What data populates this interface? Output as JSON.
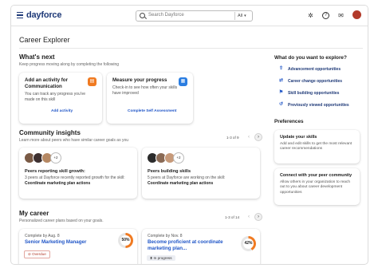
{
  "topbar": {
    "logo": "dayforce",
    "search_placeholder": "Search Dayforce",
    "search_scope": "All",
    "avatar_color": "#b23a2a"
  },
  "page": {
    "title": "Career Explorer"
  },
  "whats_next": {
    "title": "What's next",
    "subtitle": "Keep progress moving along by completing the following",
    "cards": [
      {
        "title": "Add an activity for Communication",
        "desc": "You can track any progress you've made on this skill",
        "link": "Add activity",
        "icon": "clipboard-icon",
        "color": "#f07a21"
      },
      {
        "title": "Measure your progress",
        "desc": "Check-in to see how often your skills have improved",
        "link": "Complete Self Assessment",
        "icon": "document-icon",
        "color": "#2a7de1"
      }
    ]
  },
  "community": {
    "title": "Community insights",
    "subtitle": "Learn more about peers who have similar career goals as you",
    "pager": "1-3 of 9",
    "cards": [
      {
        "avatar_more": "+2",
        "title": "Peers reporting skill growth:",
        "desc": "3 peers at Dayforce recently reported growth for the skill:",
        "skill": "Coordinate marketing plan actions"
      },
      {
        "avatar_more": "+2",
        "title": "Peers building skills",
        "desc": "5 peers at Dayforce are working on the skill:",
        "skill": "Coordinate marketing plan actions"
      }
    ]
  },
  "my_career": {
    "title": "My career",
    "subtitle": "Personalized career plans based on your goals.",
    "pager": "1-3 of 14",
    "cards": [
      {
        "due": "Complete by Aug. 8",
        "title": "Senior Marketing Manager",
        "progress": 50,
        "progress_label": "50%",
        "status": "Overdue",
        "ring_color": "#f07a21"
      },
      {
        "due": "Complete by Nov. 8",
        "title": "Become proficient at coordinate marketing plan...",
        "progress": 42,
        "progress_label": "42%",
        "status": "In progress",
        "ring_color": "#f07a21"
      }
    ]
  },
  "explore": {
    "title": "What do you want to explore?",
    "links": [
      {
        "label": "Advancement opportunities",
        "icon": "advancement-icon"
      },
      {
        "label": "Career change opportunities",
        "icon": "career-change-icon"
      },
      {
        "label": "Skill building opportunities",
        "icon": "skill-building-icon"
      },
      {
        "label": "Previously viewed opportunities",
        "icon": "history-icon"
      }
    ]
  },
  "preferences": {
    "title": "Preferences",
    "cards": [
      {
        "title": "Update your skills",
        "desc": "Add and edit skills to get the most relevant career recommendations"
      },
      {
        "title": "Connect with your peer community",
        "desc": "Allow others in your organization to reach out to you about career development opportunities"
      }
    ]
  }
}
